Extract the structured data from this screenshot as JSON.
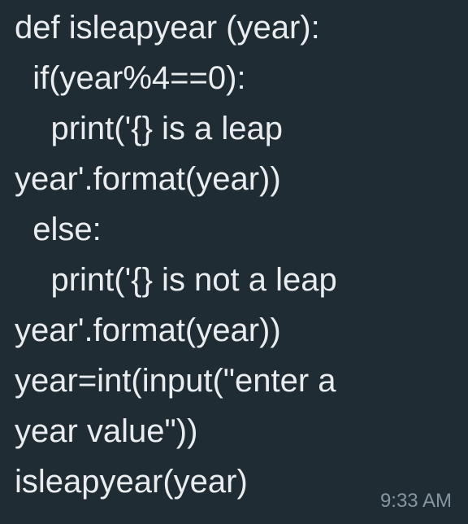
{
  "message": {
    "lines": [
      "def isleapyear (year):",
      "  if(year%4==0):",
      "    print('{} is a leap",
      "year'.format(year))",
      "  else:",
      "    print('{} is not a leap",
      "year'.format(year))",
      "year=int(input(\"enter a",
      "year value\"))",
      "isleapyear(year)"
    ],
    "time": "9:33 AM"
  },
  "colors": {
    "bubble_background": "#1f2c33",
    "text": "#e9edef",
    "timestamp": "#8696a0"
  }
}
